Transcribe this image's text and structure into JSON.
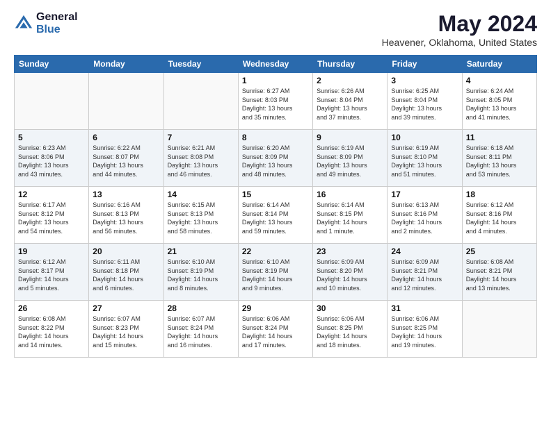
{
  "header": {
    "logo_general": "General",
    "logo_blue": "Blue",
    "title": "May 2024",
    "location": "Heavener, Oklahoma, United States"
  },
  "weekdays": [
    "Sunday",
    "Monday",
    "Tuesday",
    "Wednesday",
    "Thursday",
    "Friday",
    "Saturday"
  ],
  "weeks": [
    [
      {
        "day": "",
        "info": ""
      },
      {
        "day": "",
        "info": ""
      },
      {
        "day": "",
        "info": ""
      },
      {
        "day": "1",
        "info": "Sunrise: 6:27 AM\nSunset: 8:03 PM\nDaylight: 13 hours\nand 35 minutes."
      },
      {
        "day": "2",
        "info": "Sunrise: 6:26 AM\nSunset: 8:04 PM\nDaylight: 13 hours\nand 37 minutes."
      },
      {
        "day": "3",
        "info": "Sunrise: 6:25 AM\nSunset: 8:04 PM\nDaylight: 13 hours\nand 39 minutes."
      },
      {
        "day": "4",
        "info": "Sunrise: 6:24 AM\nSunset: 8:05 PM\nDaylight: 13 hours\nand 41 minutes."
      }
    ],
    [
      {
        "day": "5",
        "info": "Sunrise: 6:23 AM\nSunset: 8:06 PM\nDaylight: 13 hours\nand 43 minutes."
      },
      {
        "day": "6",
        "info": "Sunrise: 6:22 AM\nSunset: 8:07 PM\nDaylight: 13 hours\nand 44 minutes."
      },
      {
        "day": "7",
        "info": "Sunrise: 6:21 AM\nSunset: 8:08 PM\nDaylight: 13 hours\nand 46 minutes."
      },
      {
        "day": "8",
        "info": "Sunrise: 6:20 AM\nSunset: 8:09 PM\nDaylight: 13 hours\nand 48 minutes."
      },
      {
        "day": "9",
        "info": "Sunrise: 6:19 AM\nSunset: 8:09 PM\nDaylight: 13 hours\nand 49 minutes."
      },
      {
        "day": "10",
        "info": "Sunrise: 6:19 AM\nSunset: 8:10 PM\nDaylight: 13 hours\nand 51 minutes."
      },
      {
        "day": "11",
        "info": "Sunrise: 6:18 AM\nSunset: 8:11 PM\nDaylight: 13 hours\nand 53 minutes."
      }
    ],
    [
      {
        "day": "12",
        "info": "Sunrise: 6:17 AM\nSunset: 8:12 PM\nDaylight: 13 hours\nand 54 minutes."
      },
      {
        "day": "13",
        "info": "Sunrise: 6:16 AM\nSunset: 8:13 PM\nDaylight: 13 hours\nand 56 minutes."
      },
      {
        "day": "14",
        "info": "Sunrise: 6:15 AM\nSunset: 8:13 PM\nDaylight: 13 hours\nand 58 minutes."
      },
      {
        "day": "15",
        "info": "Sunrise: 6:14 AM\nSunset: 8:14 PM\nDaylight: 13 hours\nand 59 minutes."
      },
      {
        "day": "16",
        "info": "Sunrise: 6:14 AM\nSunset: 8:15 PM\nDaylight: 14 hours\nand 1 minute."
      },
      {
        "day": "17",
        "info": "Sunrise: 6:13 AM\nSunset: 8:16 PM\nDaylight: 14 hours\nand 2 minutes."
      },
      {
        "day": "18",
        "info": "Sunrise: 6:12 AM\nSunset: 8:16 PM\nDaylight: 14 hours\nand 4 minutes."
      }
    ],
    [
      {
        "day": "19",
        "info": "Sunrise: 6:12 AM\nSunset: 8:17 PM\nDaylight: 14 hours\nand 5 minutes."
      },
      {
        "day": "20",
        "info": "Sunrise: 6:11 AM\nSunset: 8:18 PM\nDaylight: 14 hours\nand 6 minutes."
      },
      {
        "day": "21",
        "info": "Sunrise: 6:10 AM\nSunset: 8:19 PM\nDaylight: 14 hours\nand 8 minutes."
      },
      {
        "day": "22",
        "info": "Sunrise: 6:10 AM\nSunset: 8:19 PM\nDaylight: 14 hours\nand 9 minutes."
      },
      {
        "day": "23",
        "info": "Sunrise: 6:09 AM\nSunset: 8:20 PM\nDaylight: 14 hours\nand 10 minutes."
      },
      {
        "day": "24",
        "info": "Sunrise: 6:09 AM\nSunset: 8:21 PM\nDaylight: 14 hours\nand 12 minutes."
      },
      {
        "day": "25",
        "info": "Sunrise: 6:08 AM\nSunset: 8:21 PM\nDaylight: 14 hours\nand 13 minutes."
      }
    ],
    [
      {
        "day": "26",
        "info": "Sunrise: 6:08 AM\nSunset: 8:22 PM\nDaylight: 14 hours\nand 14 minutes."
      },
      {
        "day": "27",
        "info": "Sunrise: 6:07 AM\nSunset: 8:23 PM\nDaylight: 14 hours\nand 15 minutes."
      },
      {
        "day": "28",
        "info": "Sunrise: 6:07 AM\nSunset: 8:24 PM\nDaylight: 14 hours\nand 16 minutes."
      },
      {
        "day": "29",
        "info": "Sunrise: 6:06 AM\nSunset: 8:24 PM\nDaylight: 14 hours\nand 17 minutes."
      },
      {
        "day": "30",
        "info": "Sunrise: 6:06 AM\nSunset: 8:25 PM\nDaylight: 14 hours\nand 18 minutes."
      },
      {
        "day": "31",
        "info": "Sunrise: 6:06 AM\nSunset: 8:25 PM\nDaylight: 14 hours\nand 19 minutes."
      },
      {
        "day": "",
        "info": ""
      }
    ]
  ]
}
